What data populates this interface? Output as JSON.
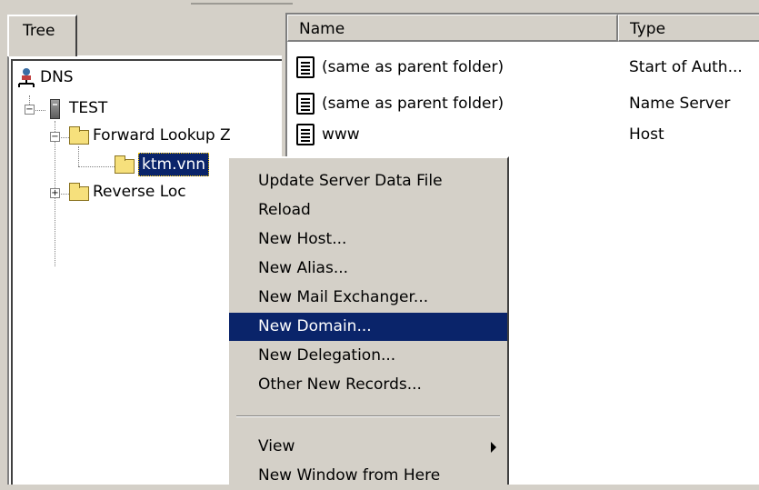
{
  "tree": {
    "tab_label": "Tree",
    "nodes": [
      {
        "label": "DNS",
        "icon": "dns-icon"
      },
      {
        "label": "TEST",
        "icon": "server-icon"
      },
      {
        "label": "Forward Lookup Z",
        "icon": "folder-icon"
      },
      {
        "label": "ktm.vnn",
        "icon": "zone-folder-icon"
      },
      {
        "label": "Reverse Loc",
        "icon": "folder-icon"
      }
    ],
    "expander_minus": "−",
    "expander_plus": "+"
  },
  "list": {
    "columns": [
      "Name",
      "Type"
    ],
    "rows": [
      {
        "name": "(same as parent folder)",
        "type": "Start of Auth..."
      },
      {
        "name": "(same as parent folder)",
        "type": "Name Server"
      },
      {
        "name": "www",
        "type": "Host"
      }
    ]
  },
  "context_menu": {
    "items": [
      {
        "label": "Update Server Data File"
      },
      {
        "label": "Reload"
      },
      {
        "label": "New Host..."
      },
      {
        "label": "New Alias..."
      },
      {
        "label": "New Mail Exchanger..."
      },
      {
        "label": "New Domain...",
        "highlighted": true
      },
      {
        "label": "New Delegation..."
      },
      {
        "label": "Other New Records..."
      },
      {
        "label": "View",
        "has_submenu": true
      },
      {
        "label": "New Window from Here"
      }
    ]
  },
  "colors": {
    "selection": "#0a246a",
    "face": "#d4d0c8"
  }
}
